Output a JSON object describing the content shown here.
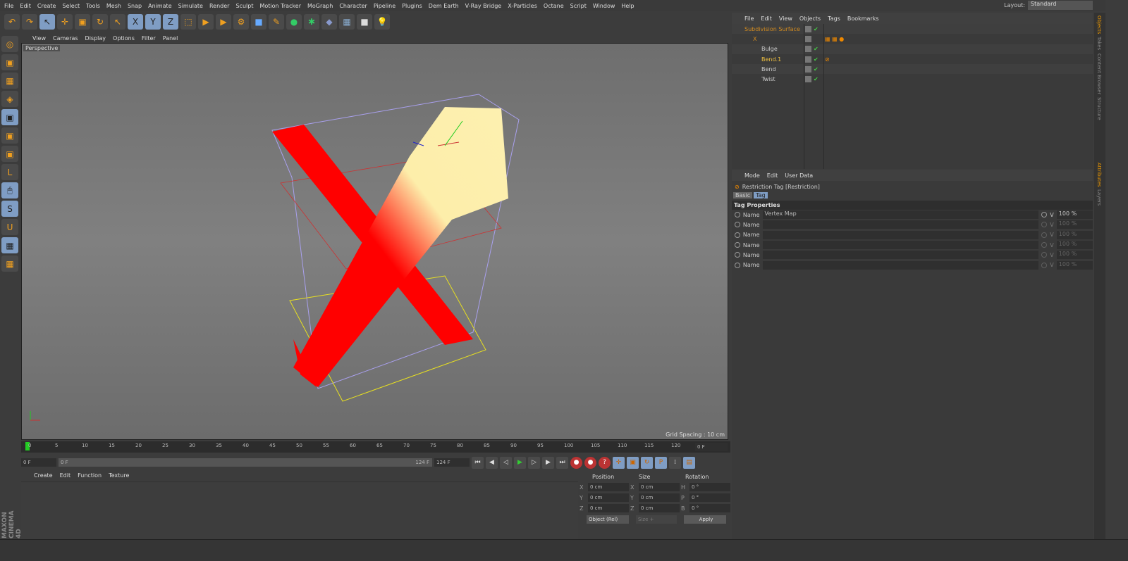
{
  "menu": [
    "File",
    "Edit",
    "Create",
    "Select",
    "Tools",
    "Mesh",
    "Snap",
    "Animate",
    "Simulate",
    "Render",
    "Sculpt",
    "Motion Tracker",
    "MoGraph",
    "Character",
    "Pipeline",
    "Plugins",
    "Dem Earth",
    "V-Ray Bridge",
    "X-Particles",
    "Octane",
    "Script",
    "Window",
    "Help"
  ],
  "layout": {
    "label": "Layout:",
    "value": "Standard"
  },
  "viewport": {
    "menu": [
      "View",
      "Cameras",
      "Display",
      "Options",
      "Filter",
      "Panel"
    ],
    "label": "Perspective",
    "grid_spacing": "Grid Spacing : 10 cm"
  },
  "timeline": {
    "ticks": [
      "0",
      "5",
      "10",
      "15",
      "20",
      "25",
      "30",
      "35",
      "40",
      "45",
      "50",
      "55",
      "60",
      "65",
      "70",
      "75",
      "80",
      "85",
      "90",
      "95",
      "100",
      "105",
      "110",
      "115",
      "120"
    ],
    "current_frame": "0 F",
    "start": "0 F",
    "range_start": "0 F",
    "range_end": "124 F",
    "end": "124 F"
  },
  "material": {
    "menu": [
      "Create",
      "Edit",
      "Function",
      "Texture"
    ]
  },
  "coords": {
    "headers": [
      "Position",
      "Size",
      "Rotation"
    ],
    "rows": [
      {
        "a": "X",
        "p": "0 cm",
        "b": "X",
        "s": "0 cm",
        "c": "H",
        "r": "0 °"
      },
      {
        "a": "Y",
        "p": "0 cm",
        "b": "Y",
        "s": "0 cm",
        "c": "P",
        "r": "0 °"
      },
      {
        "a": "Z",
        "p": "0 cm",
        "b": "Z",
        "s": "0 cm",
        "c": "B",
        "r": "0 °"
      }
    ],
    "mode": "Object (Rel)",
    "size_mode": "Size +",
    "apply": "Apply"
  },
  "objects": {
    "menu": [
      "File",
      "Edit",
      "View",
      "Objects",
      "Tags",
      "Bookmarks"
    ],
    "items": [
      {
        "name": "Subdivision Surface",
        "color": "#d08a20",
        "indent": 0
      },
      {
        "name": "X",
        "color": "#d08a20",
        "indent": 1
      },
      {
        "name": "Bulge",
        "color": "#ccc",
        "indent": 2
      },
      {
        "name": "Bend.1",
        "color": "#f0c040",
        "indent": 2
      },
      {
        "name": "Bend",
        "color": "#ccc",
        "indent": 2
      },
      {
        "name": "Twist",
        "color": "#ccc",
        "indent": 2
      }
    ]
  },
  "attributes": {
    "menu": [
      "Mode",
      "Edit",
      "User Data"
    ],
    "title": "Restriction Tag [Restriction]",
    "tabs": [
      "Basic",
      "Tag"
    ],
    "section": "Tag Properties",
    "rows": [
      {
        "label": "Name",
        "value": "Vertex Map",
        "v": "V",
        "pct": "100 %"
      },
      {
        "label": "Name",
        "value": "",
        "v": "V",
        "pct": "100 %"
      },
      {
        "label": "Name",
        "value": "",
        "v": "V",
        "pct": "100 %"
      },
      {
        "label": "Name",
        "value": "",
        "v": "V",
        "pct": "100 %"
      },
      {
        "label": "Name",
        "value": "",
        "v": "V",
        "pct": "100 %"
      },
      {
        "label": "Name",
        "value": "",
        "v": "V",
        "pct": "100 %"
      }
    ]
  },
  "side_tabs": [
    "Objects",
    "Takes",
    "Content Browser",
    "Structure",
    "Attributes",
    "Layers"
  ],
  "logo": "MAXON CINEMA 4D"
}
